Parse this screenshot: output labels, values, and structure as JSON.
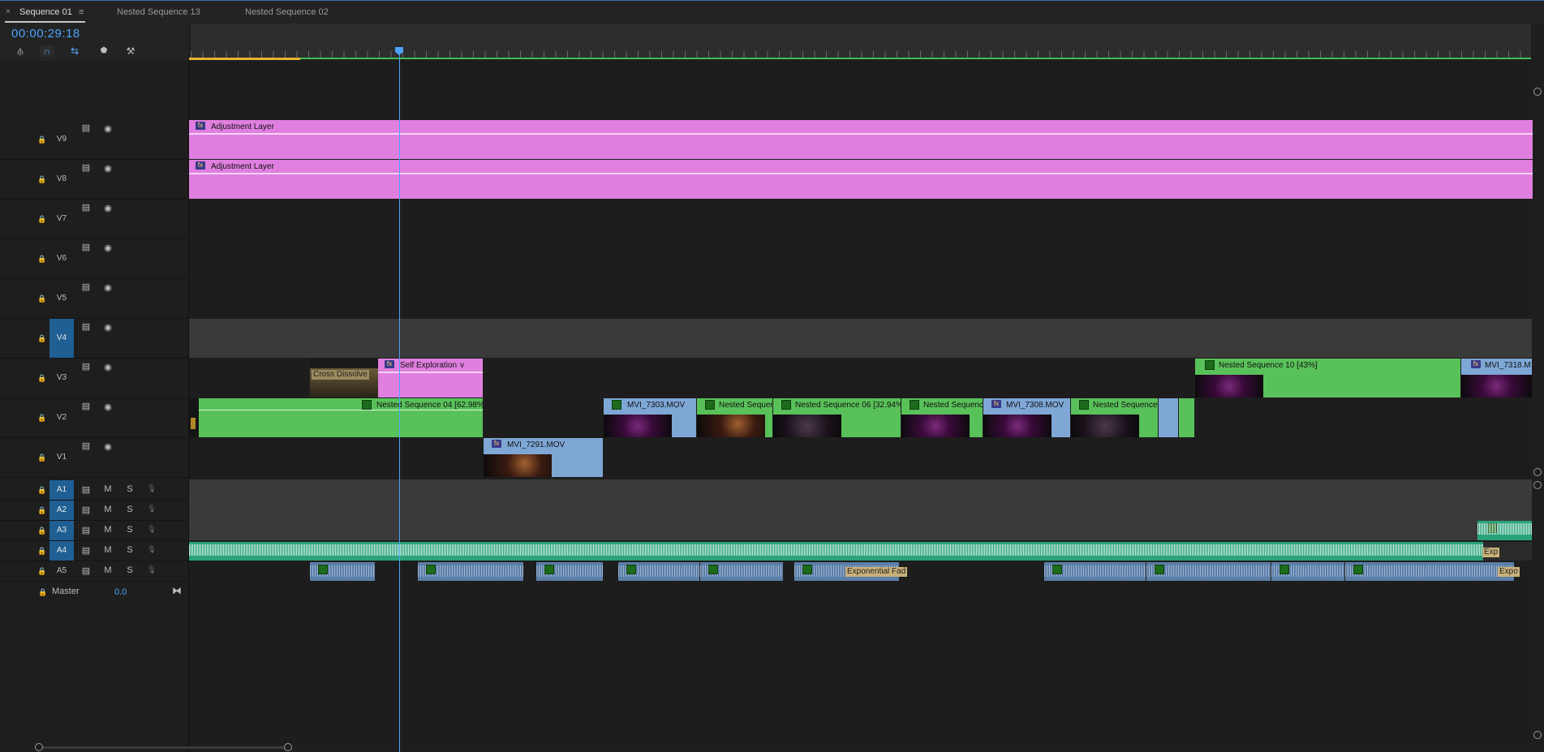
{
  "tabs": [
    {
      "label": "Sequence 01",
      "active": true
    },
    {
      "label": "Nested Sequence 13",
      "active": false
    },
    {
      "label": "Nested Sequence 02",
      "active": false
    }
  ],
  "tab_close": "×",
  "tab_menu": "≡",
  "timecode": "00:00:29:18",
  "video_tracks": [
    {
      "id": "V9",
      "selected": false
    },
    {
      "id": "V8",
      "selected": false
    },
    {
      "id": "V7",
      "selected": false
    },
    {
      "id": "V6",
      "selected": false
    },
    {
      "id": "V5",
      "selected": false
    },
    {
      "id": "V4",
      "selected": true
    },
    {
      "id": "V3",
      "selected": false
    },
    {
      "id": "V2",
      "selected": false
    },
    {
      "id": "V1",
      "selected": false
    }
  ],
  "audio_tracks": [
    {
      "id": "A1",
      "selected": true,
      "m": "M",
      "s": "S"
    },
    {
      "id": "A2",
      "selected": true,
      "m": "M",
      "s": "S"
    },
    {
      "id": "A3",
      "selected": true,
      "m": "M",
      "s": "S"
    },
    {
      "id": "A4",
      "selected": true,
      "m": "M",
      "s": "S"
    },
    {
      "id": "A5",
      "selected": false,
      "m": "M",
      "s": "S"
    }
  ],
  "master": {
    "label": "Master",
    "value": "0.0"
  },
  "clips": {
    "v9_adjustment": "Adjustment Layer",
    "v8_adjustment": "Adjustment Layer",
    "v3_cross_dissolve": "Cross Dissolve",
    "v3_self_exploration": "Self Exploration",
    "v3_self_exploration_suffix": "v",
    "v3_nested10": "Nested Sequence 10 [43%]",
    "v3_mvi7318": "MVI_7318.M",
    "v2_nested04": "Nested Sequence 04 [62.98%]",
    "v2_mvi7303": "MVI_7303.MOV",
    "v2_nested_a": "Nested Sequen",
    "v2_nested06": "Nested Sequence 06 [32.94%]",
    "v2_nested_b": "Nested Sequenc",
    "v2_mvi7308": "MVI_7308.MOV",
    "v2_nested_c": "Nested Sequence 0",
    "v1_mvi7291": "MVI_7291.MOV",
    "a5_exponential_fade": "Exponential Fad",
    "a5_expo_end": "Expo",
    "a4_expo_end": "Exp"
  },
  "icons": {
    "lock": "lock-icon",
    "film": "film-icon",
    "eye": "eye-icon",
    "mic": "mic-icon",
    "wrench": "wrench-icon",
    "marker": "marker-icon",
    "snap": "snap-icon"
  },
  "colors": {
    "accent": "#4aa3ff",
    "adjustment": "#e07fe0",
    "nested": "#59c15a",
    "video_clip": "#7ea7d6",
    "audio_clip": "#5c7fa8",
    "audio_a4": "#2aa37b"
  }
}
